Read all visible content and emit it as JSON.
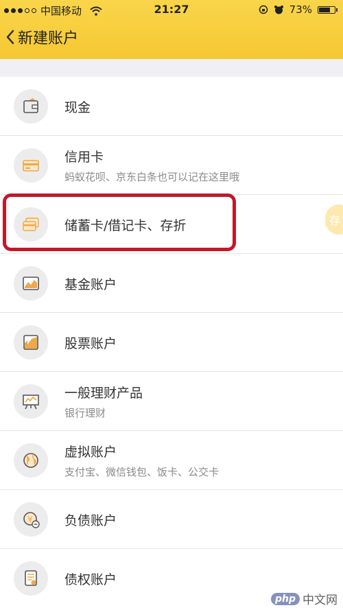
{
  "status_bar": {
    "carrier": "中国移动",
    "time": "21:27",
    "battery": "73%",
    "battery_level": 0.73,
    "signal_bars_filled": 3,
    "signal_bars_total": 5
  },
  "nav": {
    "title": "新建账户"
  },
  "accounts": [
    {
      "title": "现金",
      "subtitle": "",
      "icon": "wallet-icon"
    },
    {
      "title": "信用卡",
      "subtitle": "蚂蚁花呗、京东白条也可以记在这里哦",
      "icon": "credit-card-icon"
    },
    {
      "title": "储蓄卡/借记卡、存折",
      "subtitle": "",
      "icon": "debit-cards-icon"
    },
    {
      "title": "基金账户",
      "subtitle": "",
      "icon": "fund-chart-icon"
    },
    {
      "title": "股票账户",
      "subtitle": "",
      "icon": "stock-chart-icon"
    },
    {
      "title": "一般理财产品",
      "subtitle": "银行理财",
      "icon": "presentation-board-icon"
    },
    {
      "title": "虚拟账户",
      "subtitle": "支付宝、微信钱包、饭卡、公交卡",
      "icon": "globe-icon"
    },
    {
      "title": "负债账户",
      "subtitle": "",
      "icon": "debt-coin-icon"
    },
    {
      "title": "债权账户",
      "subtitle": "",
      "icon": "claim-document-icon"
    }
  ],
  "side_tab": {
    "label": "存"
  },
  "watermark": {
    "php": "php",
    "site": "中文网"
  },
  "colors": {
    "header": "#f7cb36",
    "highlight": "#c3172a",
    "icon_accent": "#f0a848"
  }
}
